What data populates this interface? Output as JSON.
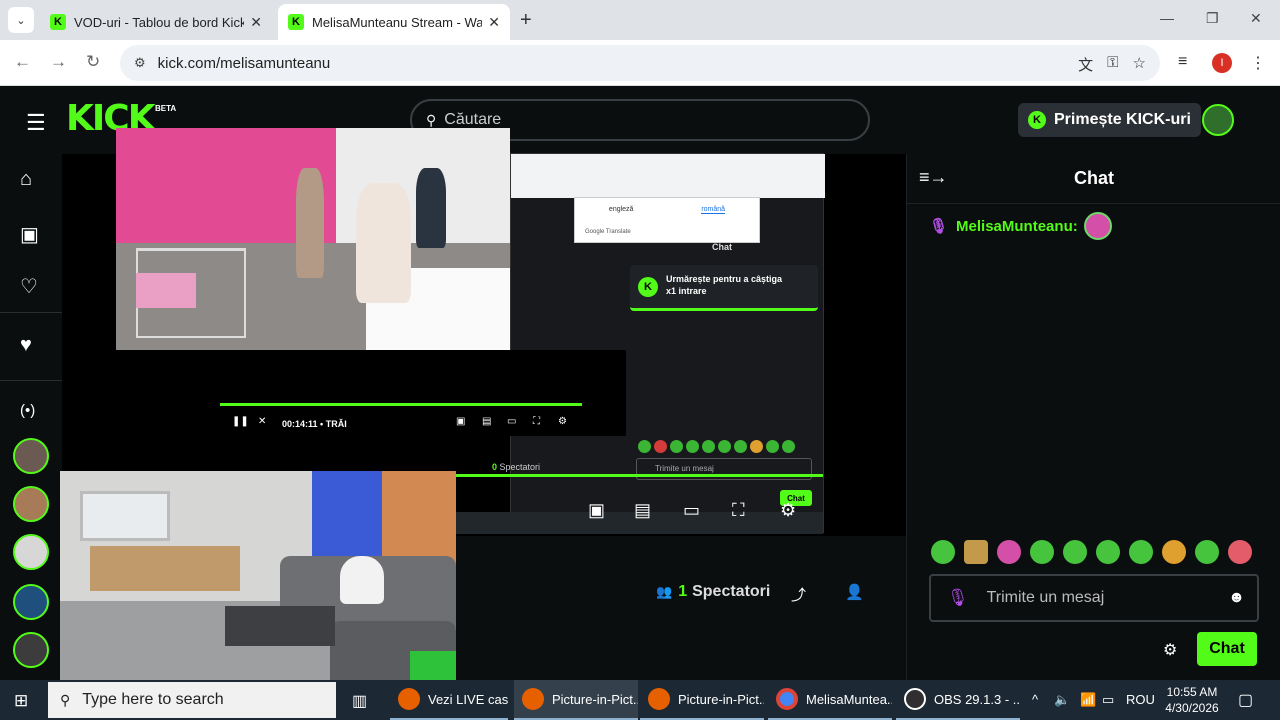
{
  "browser": {
    "tabs": [
      {
        "label": "VOD-uri - Tablou de bord Kick",
        "active": false
      },
      {
        "label": "MelisaMunteanu Stream - Watc",
        "active": true
      }
    ],
    "url": "kick.com/melisamunteanu",
    "profile_initial": "I"
  },
  "header": {
    "logo": "KICK",
    "beta": "BETA",
    "search_placeholder": "Căutare",
    "get_kicks": "Primește KICK-uri"
  },
  "nested_capture": {
    "translate_tabs": [
      "engleză",
      "română"
    ],
    "google_translate": "Google Translate",
    "chat_title": "Chat",
    "follow_line1": "Urmărește pentru a câștiga",
    "follow_line2": "x1 intrare",
    "time": "00:14:11",
    "live": "• TRĂI",
    "spectators_count": "0",
    "spectators_label": "Spectatori",
    "message_placeholder": "Trimite un mesaj",
    "chat_button": "Chat"
  },
  "stream_info": {
    "spectators_count": "1",
    "spectators_label": "Spectatori"
  },
  "chat": {
    "title": "Chat",
    "messages": [
      {
        "user": "MelisaMunteanu:"
      }
    ],
    "input_placeholder": "Trimite un mesaj",
    "send_label": "Chat"
  },
  "taskbar": {
    "search_placeholder": "Type here to search",
    "apps": [
      {
        "label": "Vezi LIVE casa...",
        "color": "#e66000"
      },
      {
        "label": "Picture-in-Pict...",
        "color": "#e66000"
      },
      {
        "label": "Picture-in-Pict...",
        "color": "#e66000"
      },
      {
        "label": "MelisaMuntea...",
        "color": "#4285f4"
      },
      {
        "label": "OBS 29.1.3 - ...",
        "color": "#302e31"
      }
    ],
    "language": "ROU",
    "time": "10:55 AM",
    "date": "4/30/2026"
  },
  "colors": {
    "accent": "#53fc18",
    "background": "#0b0e0f",
    "mic": "#b44ee8"
  }
}
